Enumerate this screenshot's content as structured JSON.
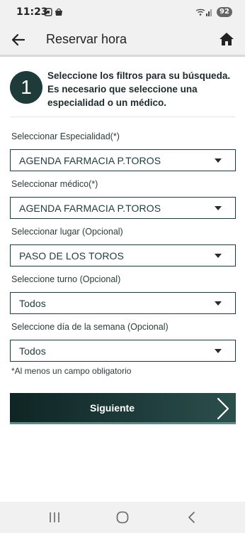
{
  "status_bar": {
    "time": "11:23",
    "battery": "92"
  },
  "header": {
    "title": "Reservar hora"
  },
  "step": {
    "number": "1",
    "instructions": "Seleccione los filtros para su búsqueda. Es necesario que seleccione una especialidad o un médico."
  },
  "fields": [
    {
      "label": "Seleccionar Especialidad(*)",
      "value": "AGENDA FARMACIA P.TOROS"
    },
    {
      "label": "Seleccionar médico(*)",
      "value": "AGENDA FARMACIA P.TOROS"
    },
    {
      "label": "Seleccionar lugar (Opcional)",
      "value": "PASO DE LOS TOROS"
    },
    {
      "label": "Seleccione turno (Opcional)",
      "value": "Todos"
    },
    {
      "label": "Seleccione día de la semana (Opcional)",
      "value": "Todos"
    }
  ],
  "note": "*Al menos un campo obligatorio",
  "next_button": {
    "label": "Siguiente"
  },
  "icons": {
    "back": "arrow-left-icon",
    "home": "home-icon",
    "next": "chevron-right-icon",
    "nav_recents": "recents-icon",
    "nav_home": "nav-home-icon",
    "nav_back": "nav-back-icon"
  },
  "colors": {
    "primary": "#1e3b3a",
    "bar": "#f1f1f1"
  }
}
